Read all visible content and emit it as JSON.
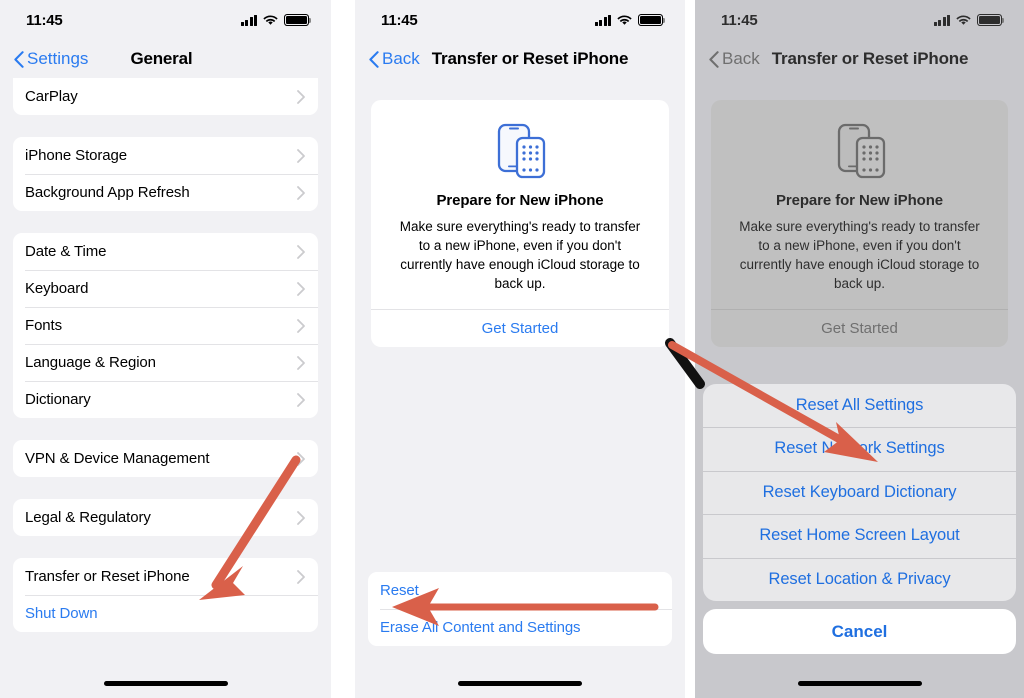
{
  "meta": {
    "accent_blue": "#2a7bf0",
    "arrow_red": "#d9604a",
    "sheet_blue": "#1f6fe0",
    "panel_bg": "#f1f1f4",
    "dimmed_bg": "#c8c8cc"
  },
  "status_bar": {
    "time": "11:45",
    "icons": [
      "cellular-signal-icon",
      "wifi-icon",
      "battery-icon"
    ]
  },
  "panel1": {
    "nav": {
      "back_label": "Settings",
      "title": "General"
    },
    "groups": [
      {
        "cut_top": true,
        "rows": [
          {
            "label": "CarPlay",
            "type": "disclosure"
          }
        ]
      },
      {
        "rows": [
          {
            "label": "iPhone Storage",
            "type": "disclosure"
          },
          {
            "label": "Background App Refresh",
            "type": "disclosure"
          }
        ]
      },
      {
        "rows": [
          {
            "label": "Date & Time",
            "type": "disclosure"
          },
          {
            "label": "Keyboard",
            "type": "disclosure"
          },
          {
            "label": "Fonts",
            "type": "disclosure"
          },
          {
            "label": "Language & Region",
            "type": "disclosure"
          },
          {
            "label": "Dictionary",
            "type": "disclosure"
          }
        ]
      },
      {
        "rows": [
          {
            "label": "VPN & Device Management",
            "type": "disclosure"
          }
        ]
      },
      {
        "rows": [
          {
            "label": "Legal & Regulatory",
            "type": "disclosure"
          }
        ]
      },
      {
        "rows": [
          {
            "label": "Transfer or Reset iPhone",
            "type": "disclosure"
          },
          {
            "label": "Shut Down",
            "type": "link"
          }
        ]
      }
    ],
    "annotation": "arrow pointing to Transfer or Reset iPhone"
  },
  "panel2": {
    "nav": {
      "back_label": "Back",
      "title": "Transfer or Reset iPhone"
    },
    "card": {
      "icon": "two-iphones-icon",
      "title": "Prepare for New iPhone",
      "body": "Make sure everything's ready to transfer to a new iPhone, even if you don't currently have enough iCloud storage to back up.",
      "action_label": "Get Started"
    },
    "bottom_rows": [
      {
        "label": "Reset",
        "type": "link"
      },
      {
        "label": "Erase All Content and Settings",
        "type": "link"
      }
    ],
    "annotation": "arrow pointing to Reset"
  },
  "panel3": {
    "nav": {
      "back_label": "Back",
      "title": "Transfer or Reset iPhone"
    },
    "card": {
      "icon": "two-iphones-icon",
      "title": "Prepare for New iPhone",
      "body": "Make sure everything's ready to transfer to a new iPhone, even if you don't currently have enough iCloud storage to back up.",
      "action_label": "Get Started"
    },
    "action_sheet": {
      "items": [
        "Reset All Settings",
        "Reset Network Settings",
        "Reset Keyboard Dictionary",
        "Reset Home Screen Layout",
        "Reset Location & Privacy"
      ],
      "cancel_label": "Cancel"
    },
    "annotation": "arrow pointing to Reset Network Settings"
  }
}
